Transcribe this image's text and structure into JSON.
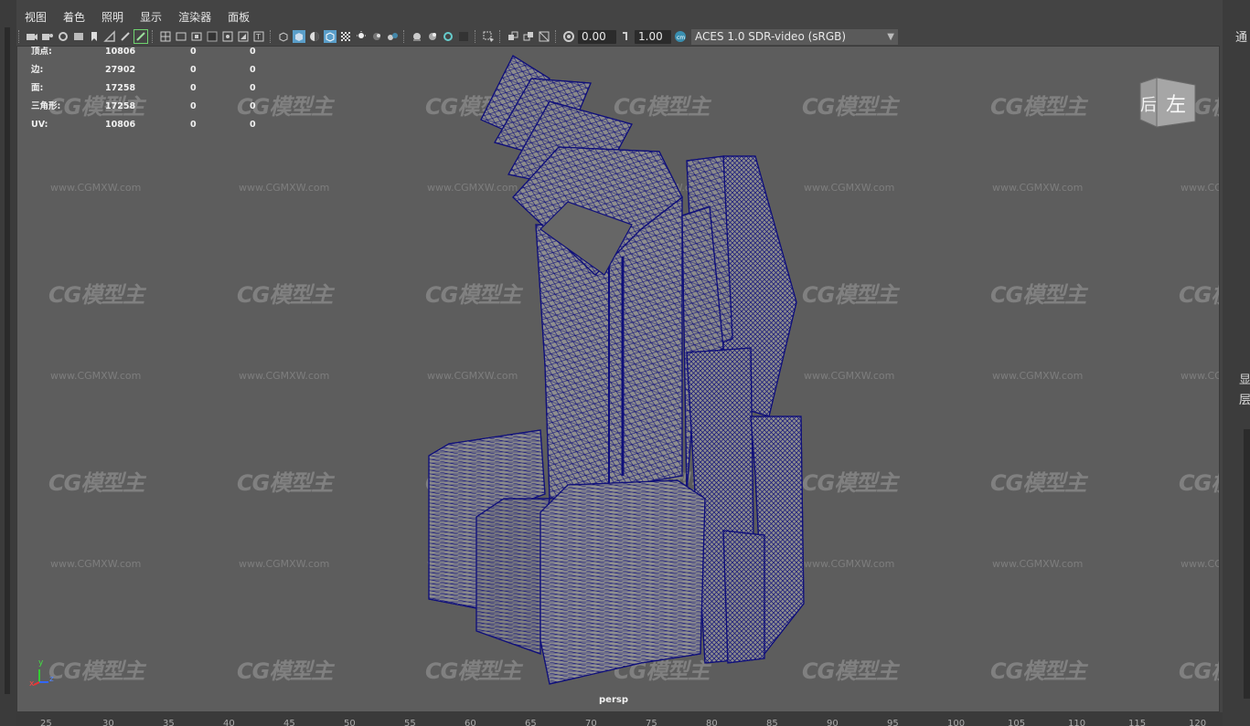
{
  "menubar": {
    "items": [
      "视图",
      "着色",
      "照明",
      "显示",
      "渲染器",
      "面板"
    ]
  },
  "toolbar": {
    "exposure": "0.00",
    "gamma": "1.00",
    "color_space": "ACES 1.0 SDR-video (sRGB)"
  },
  "right_panel": {
    "label_top": "通",
    "label_display": "显",
    "label_layer": "层"
  },
  "hud_stats": {
    "rows": [
      {
        "label": "顶点:",
        "v1": "10806",
        "v2": "0",
        "v3": "0"
      },
      {
        "label": "边:",
        "v1": "27902",
        "v2": "0",
        "v3": "0"
      },
      {
        "label": "面:",
        "v1": "17258",
        "v2": "0",
        "v3": "0"
      },
      {
        "label": "三角形:",
        "v1": "17258",
        "v2": "0",
        "v3": "0"
      },
      {
        "label": "UV:",
        "v1": "10806",
        "v2": "0",
        "v3": "0"
      }
    ]
  },
  "viewcube": {
    "back": "后",
    "left": "左"
  },
  "axis": {
    "x": "x",
    "y": "y",
    "z": "z"
  },
  "camera_label": "persp",
  "watermark": {
    "logo": "CG模型主",
    "url": "www.CGMXW.com"
  },
  "ruler": {
    "ticks": [
      "25",
      "30",
      "35",
      "40",
      "45",
      "50",
      "55",
      "60",
      "65",
      "70",
      "75",
      "80",
      "85",
      "90",
      "95",
      "100",
      "105",
      "110",
      "115",
      "120"
    ]
  },
  "colors": {
    "wireframe": "#0b0b7a",
    "viewport_bg": "#5d5d5d",
    "model_fill": "#8a8a8a"
  }
}
